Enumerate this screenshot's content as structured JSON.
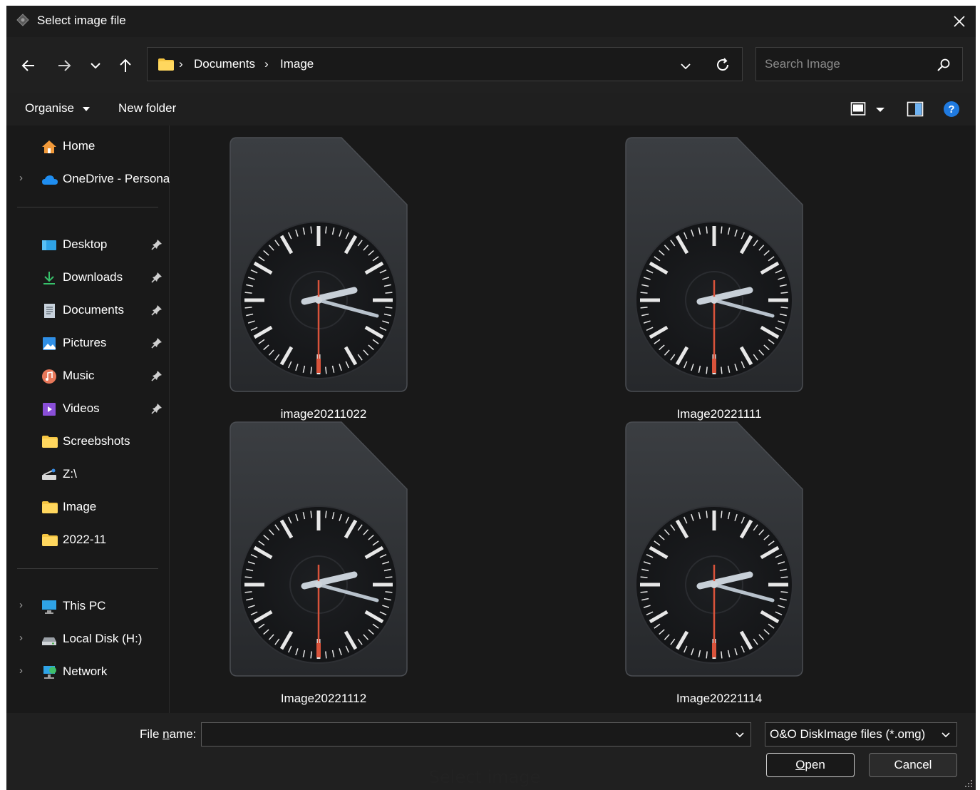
{
  "window": {
    "title": "Select image file"
  },
  "address": {
    "crumbs": [
      "Documents",
      "Image"
    ],
    "search_placeholder": "Search Image"
  },
  "toolbar": {
    "organise_label": "Organise",
    "new_folder_label": "New folder"
  },
  "nav": {
    "home": "Home",
    "onedrive": "OneDrive - Persona",
    "quick": [
      {
        "label": "Desktop"
      },
      {
        "label": "Downloads"
      },
      {
        "label": "Documents"
      },
      {
        "label": "Pictures"
      },
      {
        "label": "Music"
      },
      {
        "label": "Videos"
      },
      {
        "label": "Screebshots"
      },
      {
        "label": "Z:\\"
      },
      {
        "label": "Image"
      },
      {
        "label": "2022-11"
      }
    ],
    "this_pc": "This PC",
    "local_disk": "Local Disk (H:)",
    "network": "Network"
  },
  "files": [
    {
      "name": "image20211022"
    },
    {
      "name": "Image20221111"
    },
    {
      "name": "Image20221112"
    },
    {
      "name": "Image20221114"
    }
  ],
  "footer": {
    "file_name_label_pre": "File ",
    "file_name_label_u": "n",
    "file_name_label_post": "ame:",
    "file_name_value": "",
    "file_type": "O&O DiskImage files (*.omg)",
    "open_u": "O",
    "open_rest": "pen",
    "cancel_label": "Cancel"
  },
  "caption": "Select image",
  "colors": {
    "accent_help": "#1f7ae0",
    "folder_yellow": "#f5c542",
    "clock_hand_red": "#d9533b"
  }
}
